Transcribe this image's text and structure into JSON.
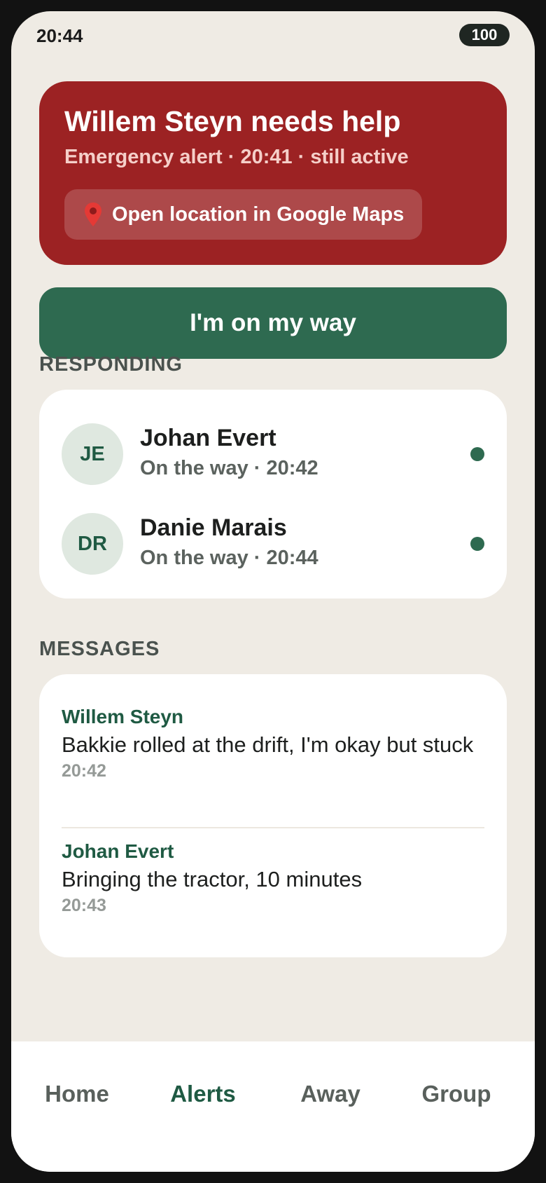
{
  "status_bar": {
    "time": "20:44",
    "battery": "100"
  },
  "alert": {
    "title": "Willem Steyn needs help",
    "subtitle": "Emergency alert · 20:41 · still active",
    "maps_label": "Open location in Google Maps",
    "maps_icon": "map-pin-icon"
  },
  "primary_action": {
    "label": "I'm on my way"
  },
  "responding": {
    "heading": "RESPONDING",
    "items": [
      {
        "initials": "JE",
        "name": "Johan Evert",
        "status": "On the way · 20:42"
      },
      {
        "initials": "DR",
        "name": "Danie Marais",
        "status": "On the way · 20:44"
      }
    ]
  },
  "messages": {
    "heading": "MESSAGES",
    "items": [
      {
        "author": "Willem Steyn",
        "text": "Bakkie rolled at the drift, I'm okay but stuck",
        "time": "20:42"
      },
      {
        "author": "Johan Evert",
        "text": "Bringing the tractor, 10 minutes",
        "time": "20:43"
      }
    ]
  },
  "nav": {
    "items": [
      {
        "label": "Home"
      },
      {
        "label": "Alerts"
      },
      {
        "label": "Away"
      },
      {
        "label": "Group"
      }
    ],
    "active": "Alerts"
  },
  "colors": {
    "alert_red": "#9c2223",
    "brand_green": "#2e6a50",
    "background": "#efebe4"
  }
}
